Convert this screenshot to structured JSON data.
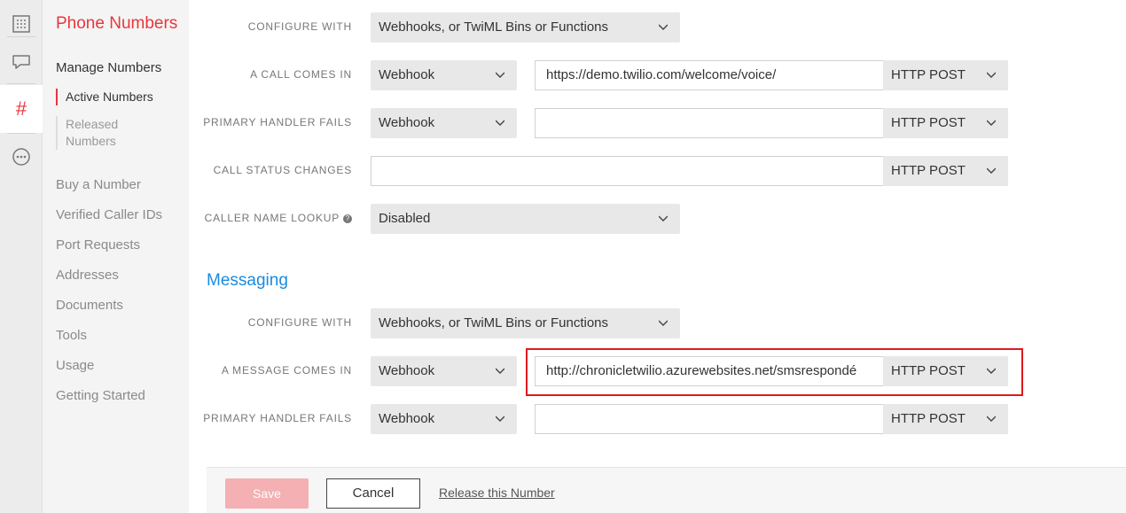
{
  "rail": {
    "items": [
      {
        "icon": "dashboard-icon",
        "glyph": "▦"
      },
      {
        "icon": "chat-icon",
        "glyph": "⬚"
      },
      {
        "icon": "hash-icon",
        "glyph": "#"
      },
      {
        "icon": "more-icon",
        "glyph": "⋯"
      }
    ]
  },
  "sidebar": {
    "title": "Phone Numbers",
    "group_head": "Manage Numbers",
    "sub_items": [
      "Active Numbers",
      "Released\nNumbers"
    ],
    "links": [
      "Buy a Number",
      "Verified Caller IDs",
      "Port Requests",
      "Addresses",
      "Documents",
      "Tools",
      "Usage",
      "Getting Started"
    ]
  },
  "voice": {
    "configure_with_label": "CONFIGURE WITH",
    "configure_with_value": "Webhooks, or TwiML Bins or Functions",
    "call_comes_in_label": "A CALL COMES IN",
    "call_comes_in_type": "Webhook",
    "call_comes_in_url": "https://demo.twilio.com/welcome/voice/",
    "call_comes_in_method": "HTTP POST",
    "primary_fails_label": "PRIMARY HANDLER FAILS",
    "primary_fails_type": "Webhook",
    "primary_fails_url": "",
    "primary_fails_method": "HTTP POST",
    "status_changes_label": "CALL STATUS CHANGES",
    "status_changes_url": "",
    "status_changes_method": "HTTP POST",
    "caller_lookup_label": "CALLER NAME LOOKUP",
    "caller_lookup_value": "Disabled"
  },
  "messaging": {
    "section_title": "Messaging",
    "configure_with_label": "CONFIGURE WITH",
    "configure_with_value": "Webhooks, or TwiML Bins or Functions",
    "message_comes_in_label": "A MESSAGE COMES IN",
    "message_comes_in_type": "Webhook",
    "message_comes_in_url": "http://chronicletwilio.azurewebsites.net/smsrespondé",
    "message_comes_in_method": "HTTP POST",
    "primary_fails_label": "PRIMARY HANDLER FAILS",
    "primary_fails_type": "Webhook",
    "primary_fails_url": "",
    "primary_fails_method": "HTTP POST"
  },
  "footer": {
    "save_label": "Save",
    "cancel_label": "Cancel",
    "release_label": "Release this Number"
  },
  "colors": {
    "brand_red": "#e8363d",
    "link_blue": "#1a8ae0",
    "highlight_red": "#e0191f"
  }
}
